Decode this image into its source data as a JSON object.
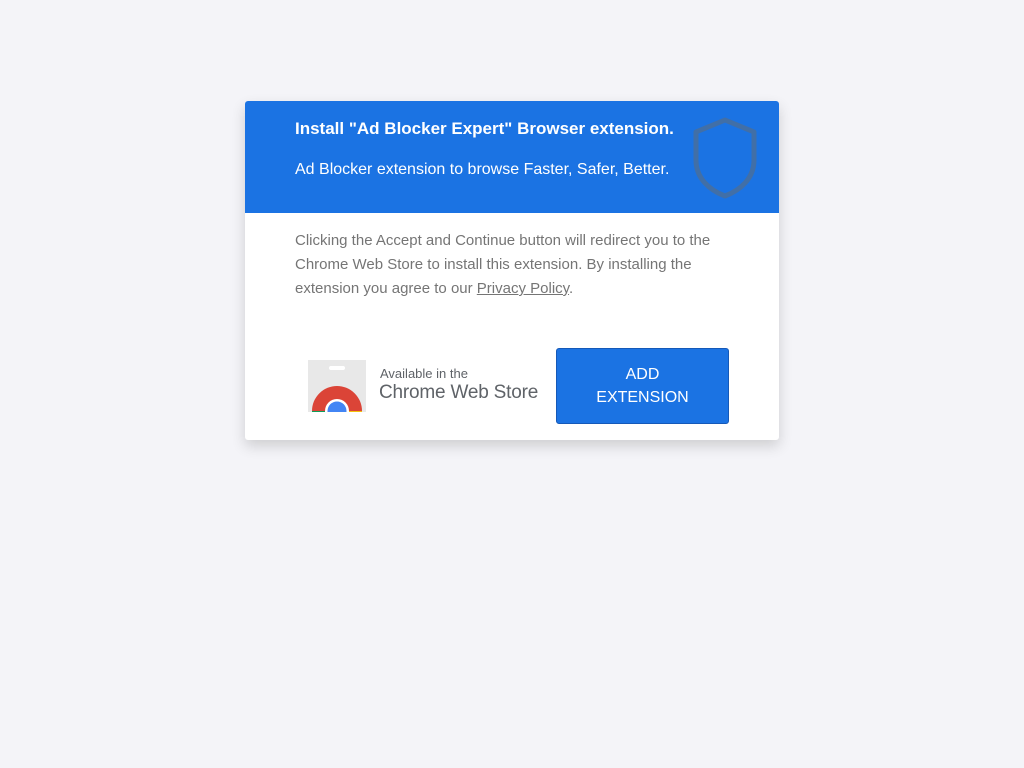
{
  "header": {
    "title": "Install \"Ad Blocker Expert\" Browser extension.",
    "subtitle": "Ad Blocker extension to browse Faster, Safer, Better.",
    "icon": "shield-icon"
  },
  "body": {
    "text_before_link": "Clicking the Accept and Continue button will redirect you to the Chrome Web Store to install this extension. By installing the extension you agree to our ",
    "link_label": "Privacy Policy",
    "text_after_link": "."
  },
  "store_badge": {
    "small_text": "Available in the",
    "large_text": "Chrome Web Store",
    "icon": "chrome-web-store-icon"
  },
  "button": {
    "line1": "ADD",
    "line2": "EXTENSION"
  },
  "colors": {
    "accent": "#1b73e3",
    "background": "#f4f4f8",
    "body_text": "#757575"
  }
}
